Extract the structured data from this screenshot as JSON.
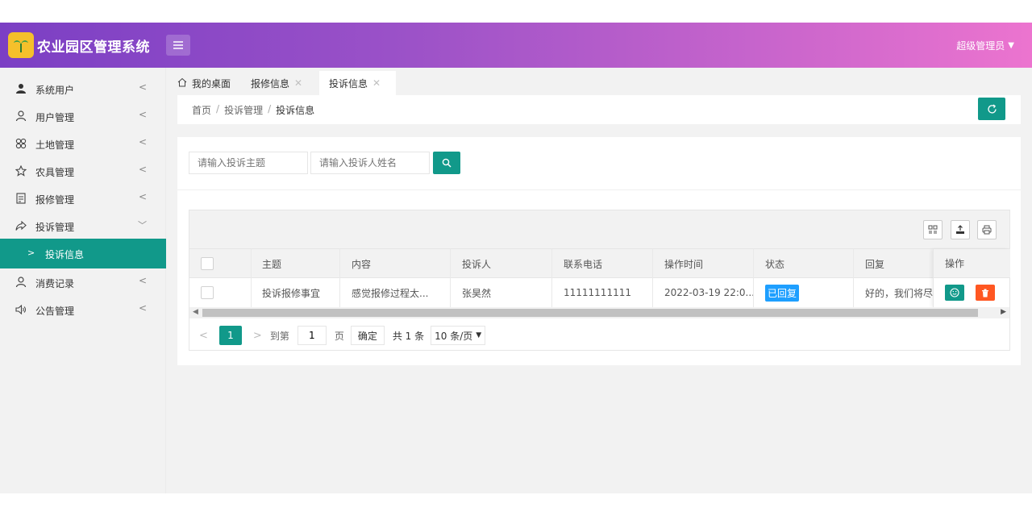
{
  "header": {
    "app_title": "农业园区管理系统",
    "user": "超级管理员"
  },
  "sidebar": {
    "items": [
      {
        "label": "系统用户",
        "icon": "user-solid-icon"
      },
      {
        "label": "用户管理",
        "icon": "user-outline-icon"
      },
      {
        "label": "土地管理",
        "icon": "cluster-icon"
      },
      {
        "label": "农具管理",
        "icon": "star-outline-icon"
      },
      {
        "label": "报修管理",
        "icon": "form-icon"
      },
      {
        "label": "投诉管理",
        "icon": "share-icon"
      },
      {
        "label": "消费记录",
        "icon": "user-outline-icon"
      },
      {
        "label": "公告管理",
        "icon": "speaker-icon"
      }
    ],
    "sub_active": "投诉信息"
  },
  "tabs": [
    {
      "label": "我的桌面"
    },
    {
      "label": "报修信息"
    },
    {
      "label": "投诉信息"
    }
  ],
  "breadcrumb": [
    "首页",
    "投诉管理",
    "投诉信息"
  ],
  "search": {
    "subject_placeholder": "请输入投诉主题",
    "name_placeholder": "请输入投诉人姓名"
  },
  "table": {
    "columns": [
      "主题",
      "内容",
      "投诉人",
      "联系电话",
      "操作时间",
      "状态",
      "回复",
      "操作"
    ],
    "rows": [
      {
        "subject": "投诉报修事宜",
        "content": "感觉报修过程太...",
        "complainant": "张昊然",
        "phone": "11111111111",
        "time": "2022-03-19 22:0...",
        "status": "已回复",
        "reply": "好的，我们将尽..."
      }
    ]
  },
  "pager": {
    "current": "1",
    "goto_label": "到第",
    "goto_value": "1",
    "page_unit": "页",
    "confirm": "确定",
    "total": "共 1 条",
    "page_size": "10 条/页"
  },
  "colors": {
    "accent": "#11998a",
    "status_blue": "#1e9fff",
    "danger": "#ff5722"
  }
}
